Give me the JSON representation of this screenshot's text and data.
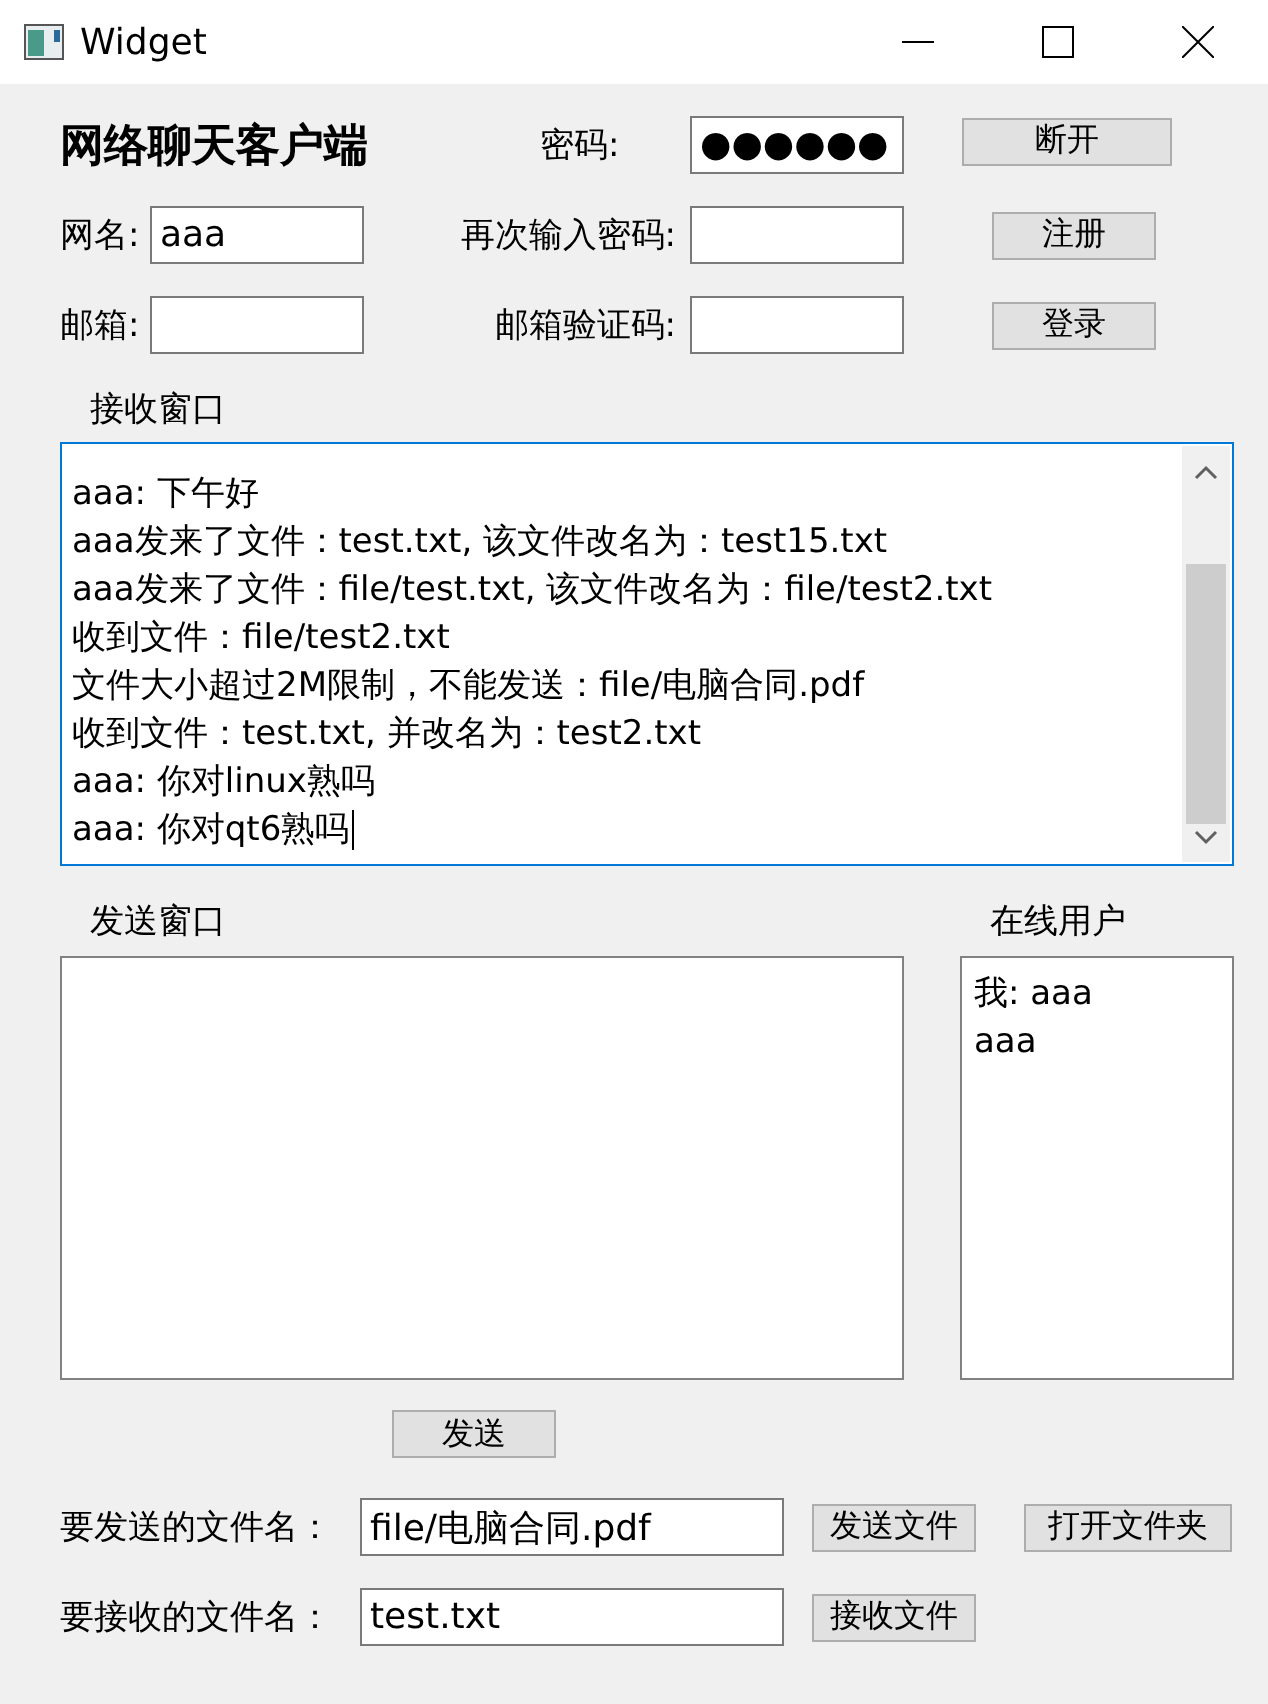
{
  "window": {
    "title": "Widget"
  },
  "header": {
    "title": "网络聊天客户端"
  },
  "password": {
    "label": "密码:",
    "value": "●●●●●●"
  },
  "disconnect_button": "断开",
  "nickname": {
    "label": "网名:",
    "value": "aaa"
  },
  "confirm_password": {
    "label": "再次输入密码:"
  },
  "register_button": "注册",
  "email": {
    "label": "邮箱:"
  },
  "email_code": {
    "label": "邮箱验证码:"
  },
  "login_button": "登录",
  "receive_window": {
    "label": "接收窗口",
    "lines": [
      "aaa: 下午好",
      "aaa发来了文件：test.txt, 该文件改名为：test15.txt",
      "aaa发来了文件：file/test.txt, 该文件改名为：file/test2.txt",
      "收到文件：file/test2.txt",
      "文件大小超过2M限制，不能发送：file/电脑合同.pdf",
      "收到文件：test.txt, 并改名为：test2.txt",
      "aaa: 你对linux熟吗",
      "aaa: 你对qt6熟吗"
    ]
  },
  "send_window": {
    "label": "发送窗口"
  },
  "online_users": {
    "label": "在线用户",
    "items": [
      "我: aaa",
      "aaa"
    ]
  },
  "send_button": "发送",
  "send_file": {
    "label": "要发送的文件名：",
    "value": "file/电脑合同.pdf",
    "buttons": [
      "发送文件",
      "打开文件夹"
    ]
  },
  "receive_file": {
    "label": "要接收的文件名：",
    "value": "test.txt",
    "button": "接收文件"
  }
}
